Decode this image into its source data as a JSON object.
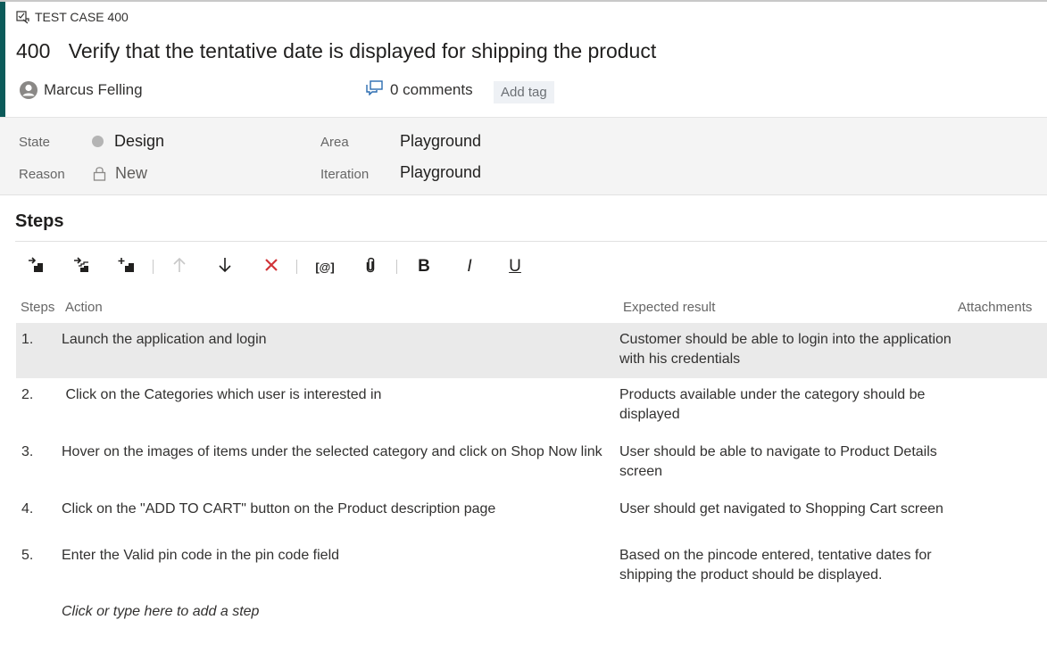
{
  "work_item": {
    "type_label": "TEST CASE 400",
    "id": "400",
    "title": "Verify that the tentative date is displayed for shipping the product",
    "assignee": "Marcus Felling",
    "comments_label": "0 comments",
    "add_tag_label": "Add tag"
  },
  "fields": {
    "state_label": "State",
    "state_value": "Design",
    "reason_label": "Reason",
    "reason_value": "New",
    "area_label": "Area",
    "area_value": "Playground",
    "iteration_label": "Iteration",
    "iteration_value": "Playground"
  },
  "steps_section": {
    "title": "Steps",
    "toolbar": {
      "bold": "B",
      "italic": "I",
      "underline": "U",
      "parameter": "[@]"
    },
    "columns": {
      "steps": "Steps",
      "action": "Action",
      "expected": "Expected result",
      "attachments": "Attachments"
    },
    "rows": [
      {
        "num": "1.",
        "action": "Launch the application and login",
        "expected": "Customer  should be able to login into the application with his credentials"
      },
      {
        "num": "2.",
        "action": " Click on the Categories which user is interested in",
        "expected": "Products available under the category should be displayed"
      },
      {
        "num": "3.",
        "action": "Hover on the images of items under the selected category and click on Shop Now link",
        "expected": "User should be able to navigate to Product Details screen"
      },
      {
        "num": "4.",
        "action": "Click on the \"ADD TO CART\" button on the Product description page",
        "expected": "User should get navigated to Shopping Cart screen"
      },
      {
        "num": "5.",
        "action": "Enter the Valid pin code in the pin code field",
        "expected": "Based on the pincode entered, tentative dates for shipping the product should be displayed."
      }
    ],
    "add_step_placeholder": "Click or type here to add a step"
  },
  "colors": {
    "accent": "#0b5b5a",
    "delete_red": "#d13438",
    "selected_row": "#eaeaea"
  },
  "icons": [
    "test-case-icon",
    "user-avatar-icon",
    "comment-icon",
    "lock-icon",
    "insert-step-icon",
    "insert-shared-steps-icon",
    "create-shared-steps-icon",
    "move-up-icon",
    "move-down-icon",
    "delete-step-icon",
    "insert-parameter-icon",
    "attachment-icon"
  ]
}
